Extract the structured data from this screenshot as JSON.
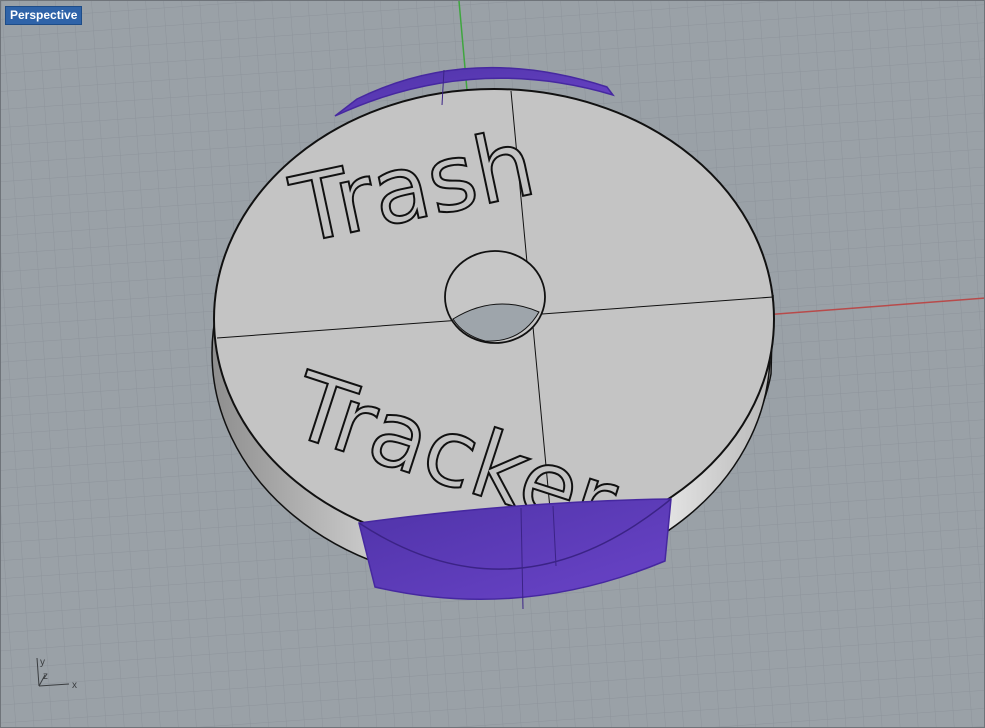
{
  "viewport": {
    "title": "Perspective",
    "background_color": "#9aa1a7",
    "grid_color": "#8c939a",
    "x_axis_color": "#b84a4a",
    "y_axis_color": "#3fa63f"
  },
  "model": {
    "top_text": "Trash",
    "bottom_text": "Tracker",
    "disc_color": "#c4c4c4",
    "selection_color": "#6a44c8"
  },
  "axis_widget": {
    "y_label": "y",
    "z_label": "z",
    "x_label": "x"
  }
}
